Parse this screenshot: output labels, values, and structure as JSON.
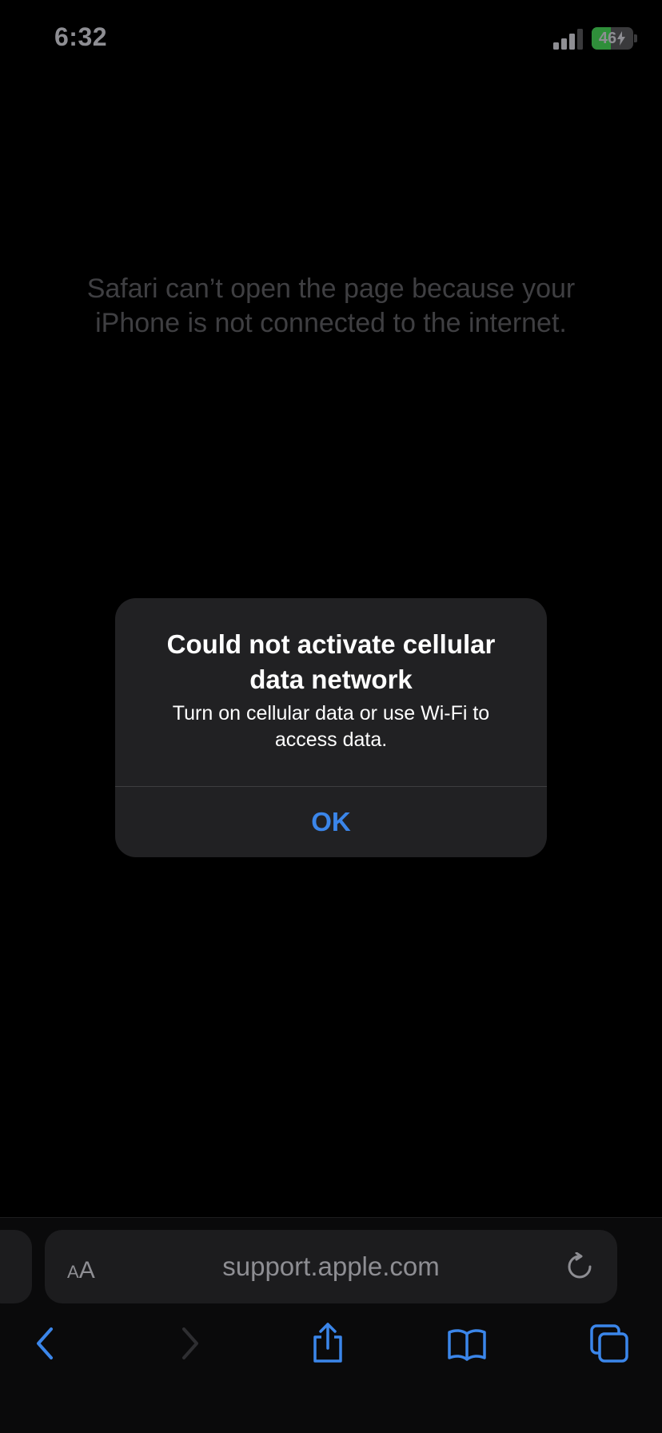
{
  "status_bar": {
    "time": "6:32",
    "battery_level": "46",
    "battery_fraction": 0.46,
    "charging": true,
    "signal_bars_active": 3,
    "signal_bars_total": 4
  },
  "page": {
    "error_message": "Safari can’t open the page because your iPhone is not connected to the internet."
  },
  "alert": {
    "title": "Could not activate cellular data network",
    "message": "Turn on cellular data or use Wi-Fi to access data.",
    "button_label": "OK"
  },
  "address_bar": {
    "format_button_small": "A",
    "format_button_large": "A",
    "url": "support.apple.com",
    "reload_icon": "reload-icon"
  },
  "toolbar": {
    "items": [
      {
        "icon": "back-icon",
        "enabled": true
      },
      {
        "icon": "forward-icon",
        "enabled": false
      },
      {
        "icon": "share-icon",
        "enabled": true
      },
      {
        "icon": "bookmarks-icon",
        "enabled": true
      },
      {
        "icon": "tabs-icon",
        "enabled": true
      }
    ]
  },
  "colors": {
    "accent": "#3b86ea",
    "background": "#000000",
    "alert_background": "#212123",
    "muted_text": "#8e8e93",
    "battery_green": "#2f8f3a"
  }
}
